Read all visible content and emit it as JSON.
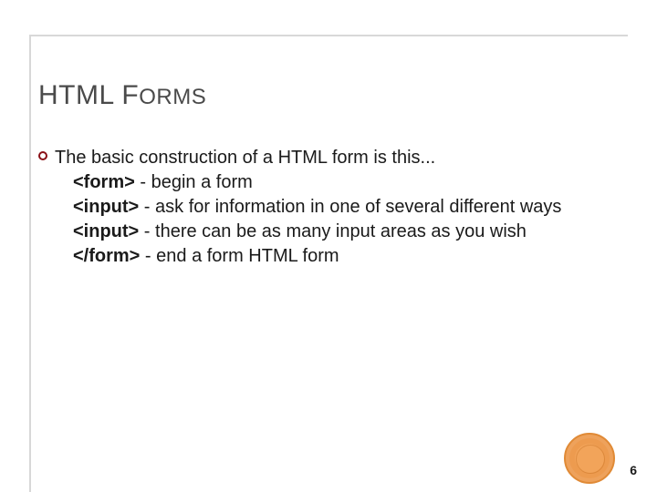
{
  "title": {
    "main": "HTML F",
    "smallcaps": "ORMS"
  },
  "bullet": {
    "intro": "The basic construction of a HTML form is this...",
    "lines": [
      {
        "tag": "<form>",
        "sep": "   - ",
        "desc": "begin a form",
        "indent": true
      },
      {
        "tag": "<input>",
        "sep": "  - ",
        "desc": "ask for information in one of several different ways",
        "indent": true,
        "wrap": true
      },
      {
        "tag": "<input>",
        "sep": "  - ",
        "desc": "there can be as many input areas as you wish",
        "indent": true,
        "wrap": true
      },
      {
        "tag": "</form>",
        "sep": "  - ",
        "desc": "end a form HTML form",
        "indent": true
      }
    ]
  },
  "page_number": "6"
}
